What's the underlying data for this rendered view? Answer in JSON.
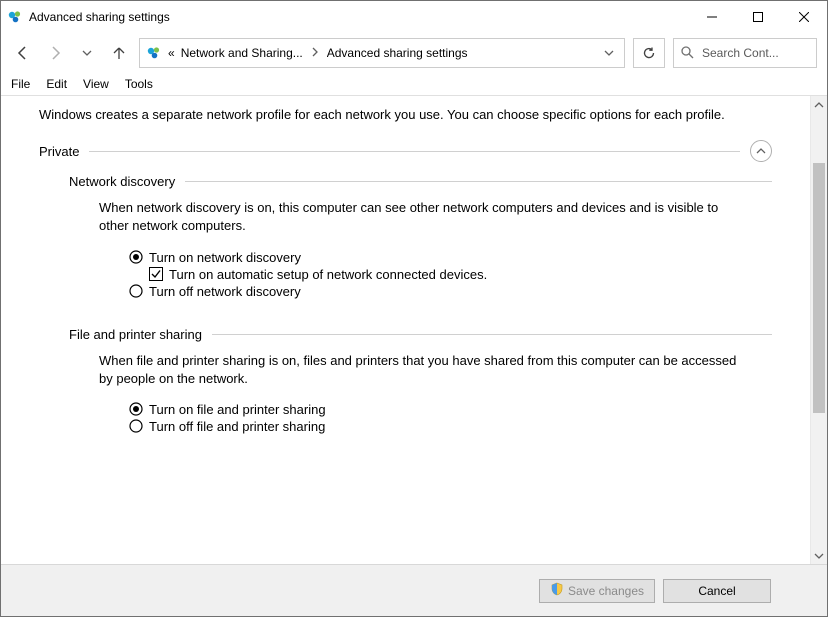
{
  "window": {
    "title": "Advanced sharing settings"
  },
  "breadcrumb": {
    "prefix": "«",
    "seg0": "Network and Sharing...",
    "seg1": "Advanced sharing settings"
  },
  "search": {
    "placeholder": "Search Cont..."
  },
  "menu": {
    "file": "File",
    "edit": "Edit",
    "view": "View",
    "tools": "Tools"
  },
  "page": {
    "intro": "Windows creates a separate network profile for each network you use. You can choose specific options for each profile.",
    "private": {
      "title": "Private",
      "network_discovery": {
        "heading": "Network discovery",
        "desc": "When network discovery is on, this computer can see other network computers and devices and is visible to other network computers.",
        "opt_on": "Turn on network discovery",
        "opt_auto": "Turn on automatic setup of network connected devices.",
        "opt_off": "Turn off network discovery"
      },
      "file_printer": {
        "heading": "File and printer sharing",
        "desc": "When file and printer sharing is on, files and printers that you have shared from this computer can be accessed by people on the network.",
        "opt_on": "Turn on file and printer sharing",
        "opt_off": "Turn off file and printer sharing"
      }
    }
  },
  "footer": {
    "save": "Save changes",
    "cancel": "Cancel"
  }
}
